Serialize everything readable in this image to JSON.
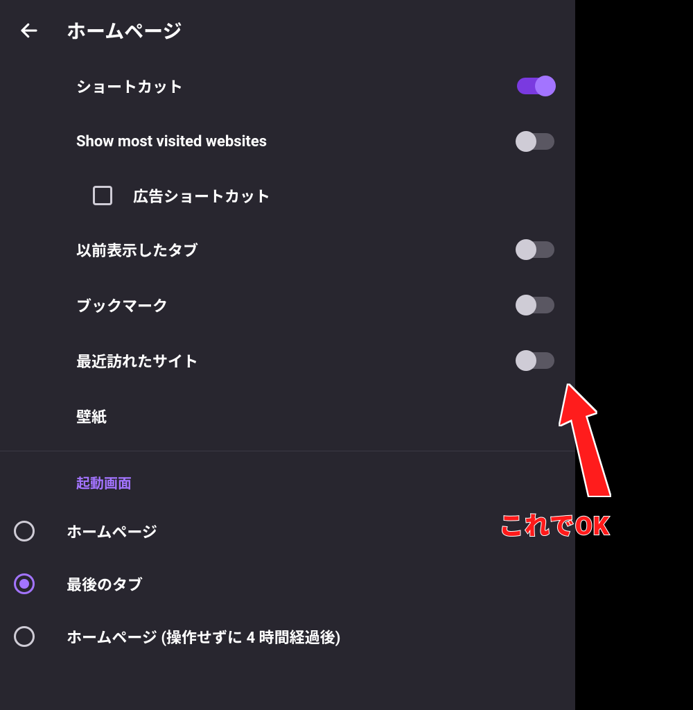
{
  "header": {
    "title": "ホームページ"
  },
  "settings": {
    "shortcuts": {
      "label": "ショートカット",
      "on": true
    },
    "most_visited": {
      "label": "Show most visited websites",
      "on": false
    },
    "ad_shortcut": {
      "label": "広告ショートカット",
      "checked": false
    },
    "prev_tabs": {
      "label": "以前表示したタブ",
      "on": false
    },
    "bookmarks": {
      "label": "ブックマーク",
      "on": false
    },
    "recent_sites": {
      "label": "最近訪れたサイト",
      "on": false
    },
    "wallpaper": {
      "label": "壁紙"
    }
  },
  "startup": {
    "section": "起動画面",
    "options": [
      {
        "label": "ホームページ",
        "selected": false
      },
      {
        "label": "最後のタブ",
        "selected": true
      },
      {
        "label": "ホームページ (操作せずに 4 時間経過後)",
        "selected": false
      }
    ]
  },
  "annotation": {
    "text": "これでOK"
  }
}
